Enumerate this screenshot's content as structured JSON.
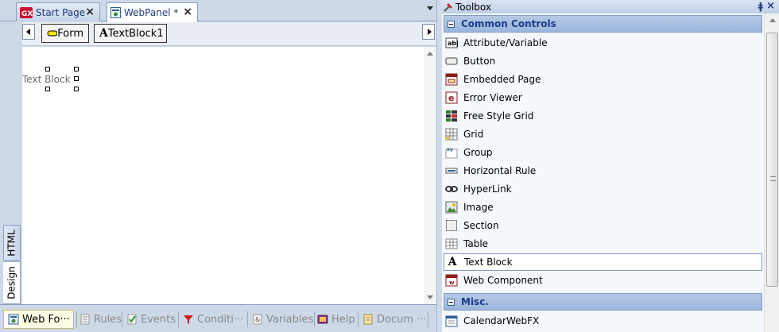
{
  "editor": {
    "tabs": [
      {
        "label": "Start Page",
        "close": "×"
      },
      {
        "label": "WebPanel *",
        "close": "×"
      }
    ],
    "breadcrumb": [
      {
        "label": "Form"
      },
      {
        "label": "TextBlock1"
      }
    ],
    "canvas_text": "Text Block",
    "side_tabs": {
      "html": "HTML",
      "design": "Design"
    },
    "part_tabs": [
      {
        "label": "Web Fo···"
      },
      {
        "label": "Rules"
      },
      {
        "label": "Events"
      },
      {
        "label": "Conditi···"
      },
      {
        "label": "Variables"
      },
      {
        "label": "Help"
      },
      {
        "label": "Docum ···"
      }
    ]
  },
  "toolbox": {
    "title": "Toolbox",
    "pin": "ǂ",
    "close": "×",
    "groups": [
      {
        "label": "Common Controls",
        "items": [
          {
            "label": "Attribute/Variable",
            "icon": "attribute-variable-icon"
          },
          {
            "label": "Button",
            "icon": "button-icon"
          },
          {
            "label": "Embedded Page",
            "icon": "embedded-page-icon"
          },
          {
            "label": "Error Viewer",
            "icon": "error-viewer-icon"
          },
          {
            "label": "Free Style Grid",
            "icon": "free-style-grid-icon"
          },
          {
            "label": "Grid",
            "icon": "grid-icon"
          },
          {
            "label": "Group",
            "icon": "group-icon"
          },
          {
            "label": "Horizontal Rule",
            "icon": "horizontal-rule-icon"
          },
          {
            "label": "HyperLink",
            "icon": "hyperlink-icon"
          },
          {
            "label": "Image",
            "icon": "image-icon"
          },
          {
            "label": "Section",
            "icon": "section-icon"
          },
          {
            "label": "Table",
            "icon": "table-icon"
          },
          {
            "label": "Text Block",
            "icon": "text-block-icon",
            "selected": true
          },
          {
            "label": "Web Component",
            "icon": "web-component-icon"
          }
        ]
      },
      {
        "label": "Misc.",
        "items": [
          {
            "label": "CalendarWebFX",
            "icon": "calendar-icon"
          }
        ]
      }
    ]
  },
  "colors": {
    "chrome": "#ced9e8",
    "group_header": "#b5cae6",
    "group_text": "#1a3c84"
  }
}
